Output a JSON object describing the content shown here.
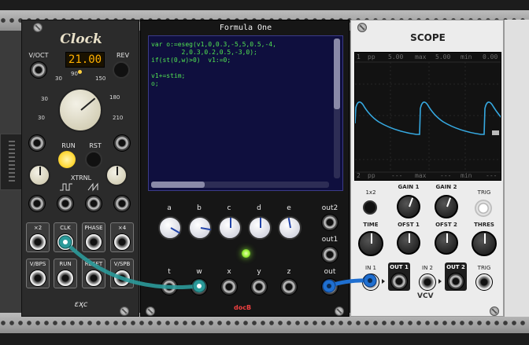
{
  "clock": {
    "title": "Clock",
    "voct_label": "V/OCT",
    "display_value": "21.00",
    "rev_label": "REV",
    "ticks": [
      "30",
      "60",
      "90",
      "150",
      "180",
      "210"
    ],
    "run_label": "RUN",
    "rst_label": "RST",
    "xtrnl_label": "XTRNL",
    "outs": [
      {
        "label": "×2"
      },
      {
        "label": "CLK"
      },
      {
        "label": "PHASE"
      },
      {
        "label": "×4"
      },
      {
        "label": "V/BPS"
      },
      {
        "label": "RUN"
      },
      {
        "label": "RESET"
      },
      {
        "label": "V/SPB"
      }
    ],
    "brand": "ɛҳc"
  },
  "formula": {
    "title": "Formula One",
    "code": "var o:=eseg(v1,0,0.3,-5,5,0.5,-4,\n        2,0.3,0.2,0.5,-3,0);\nif(st(0,w)>0)  v1:=0;\n\nv1+=stim;\no;",
    "knobs": [
      "a",
      "b",
      "c",
      "d",
      "e"
    ],
    "inputs": [
      "t",
      "w",
      "x",
      "y",
      "z"
    ],
    "out2_label": "out2",
    "out1_label": "out1",
    "out_label": "out",
    "brand": "docB"
  },
  "scope": {
    "title": "SCOPE",
    "ch1": {
      "num": "1",
      "pp_label": "pp",
      "pp": "5.00",
      "max_label": "max",
      "max": "5.00",
      "min_label": "min",
      "min": "0.00"
    },
    "ch2": {
      "num": "2",
      "pp_label": "pp",
      "pp": "---",
      "max_label": "max",
      "max": "---",
      "min_label": "min",
      "min": "---"
    },
    "labels": {
      "x12": "1x2",
      "gain1": "GAIN 1",
      "gain2": "GAIN 2",
      "trig": "TRIG",
      "time": "TIME",
      "ofst1": "OFST 1",
      "ofst2": "OFST 2",
      "thres": "THRES",
      "in1": "IN 1",
      "out1": "OUT 1",
      "in2": "IN 2",
      "out2": "OUT 2",
      "trig2": "TRIG"
    },
    "brand": "VCV",
    "trace_color": "#36a9e1"
  },
  "cables": {
    "teal": "#2b9a9a",
    "blue": "#1f6fd0"
  }
}
